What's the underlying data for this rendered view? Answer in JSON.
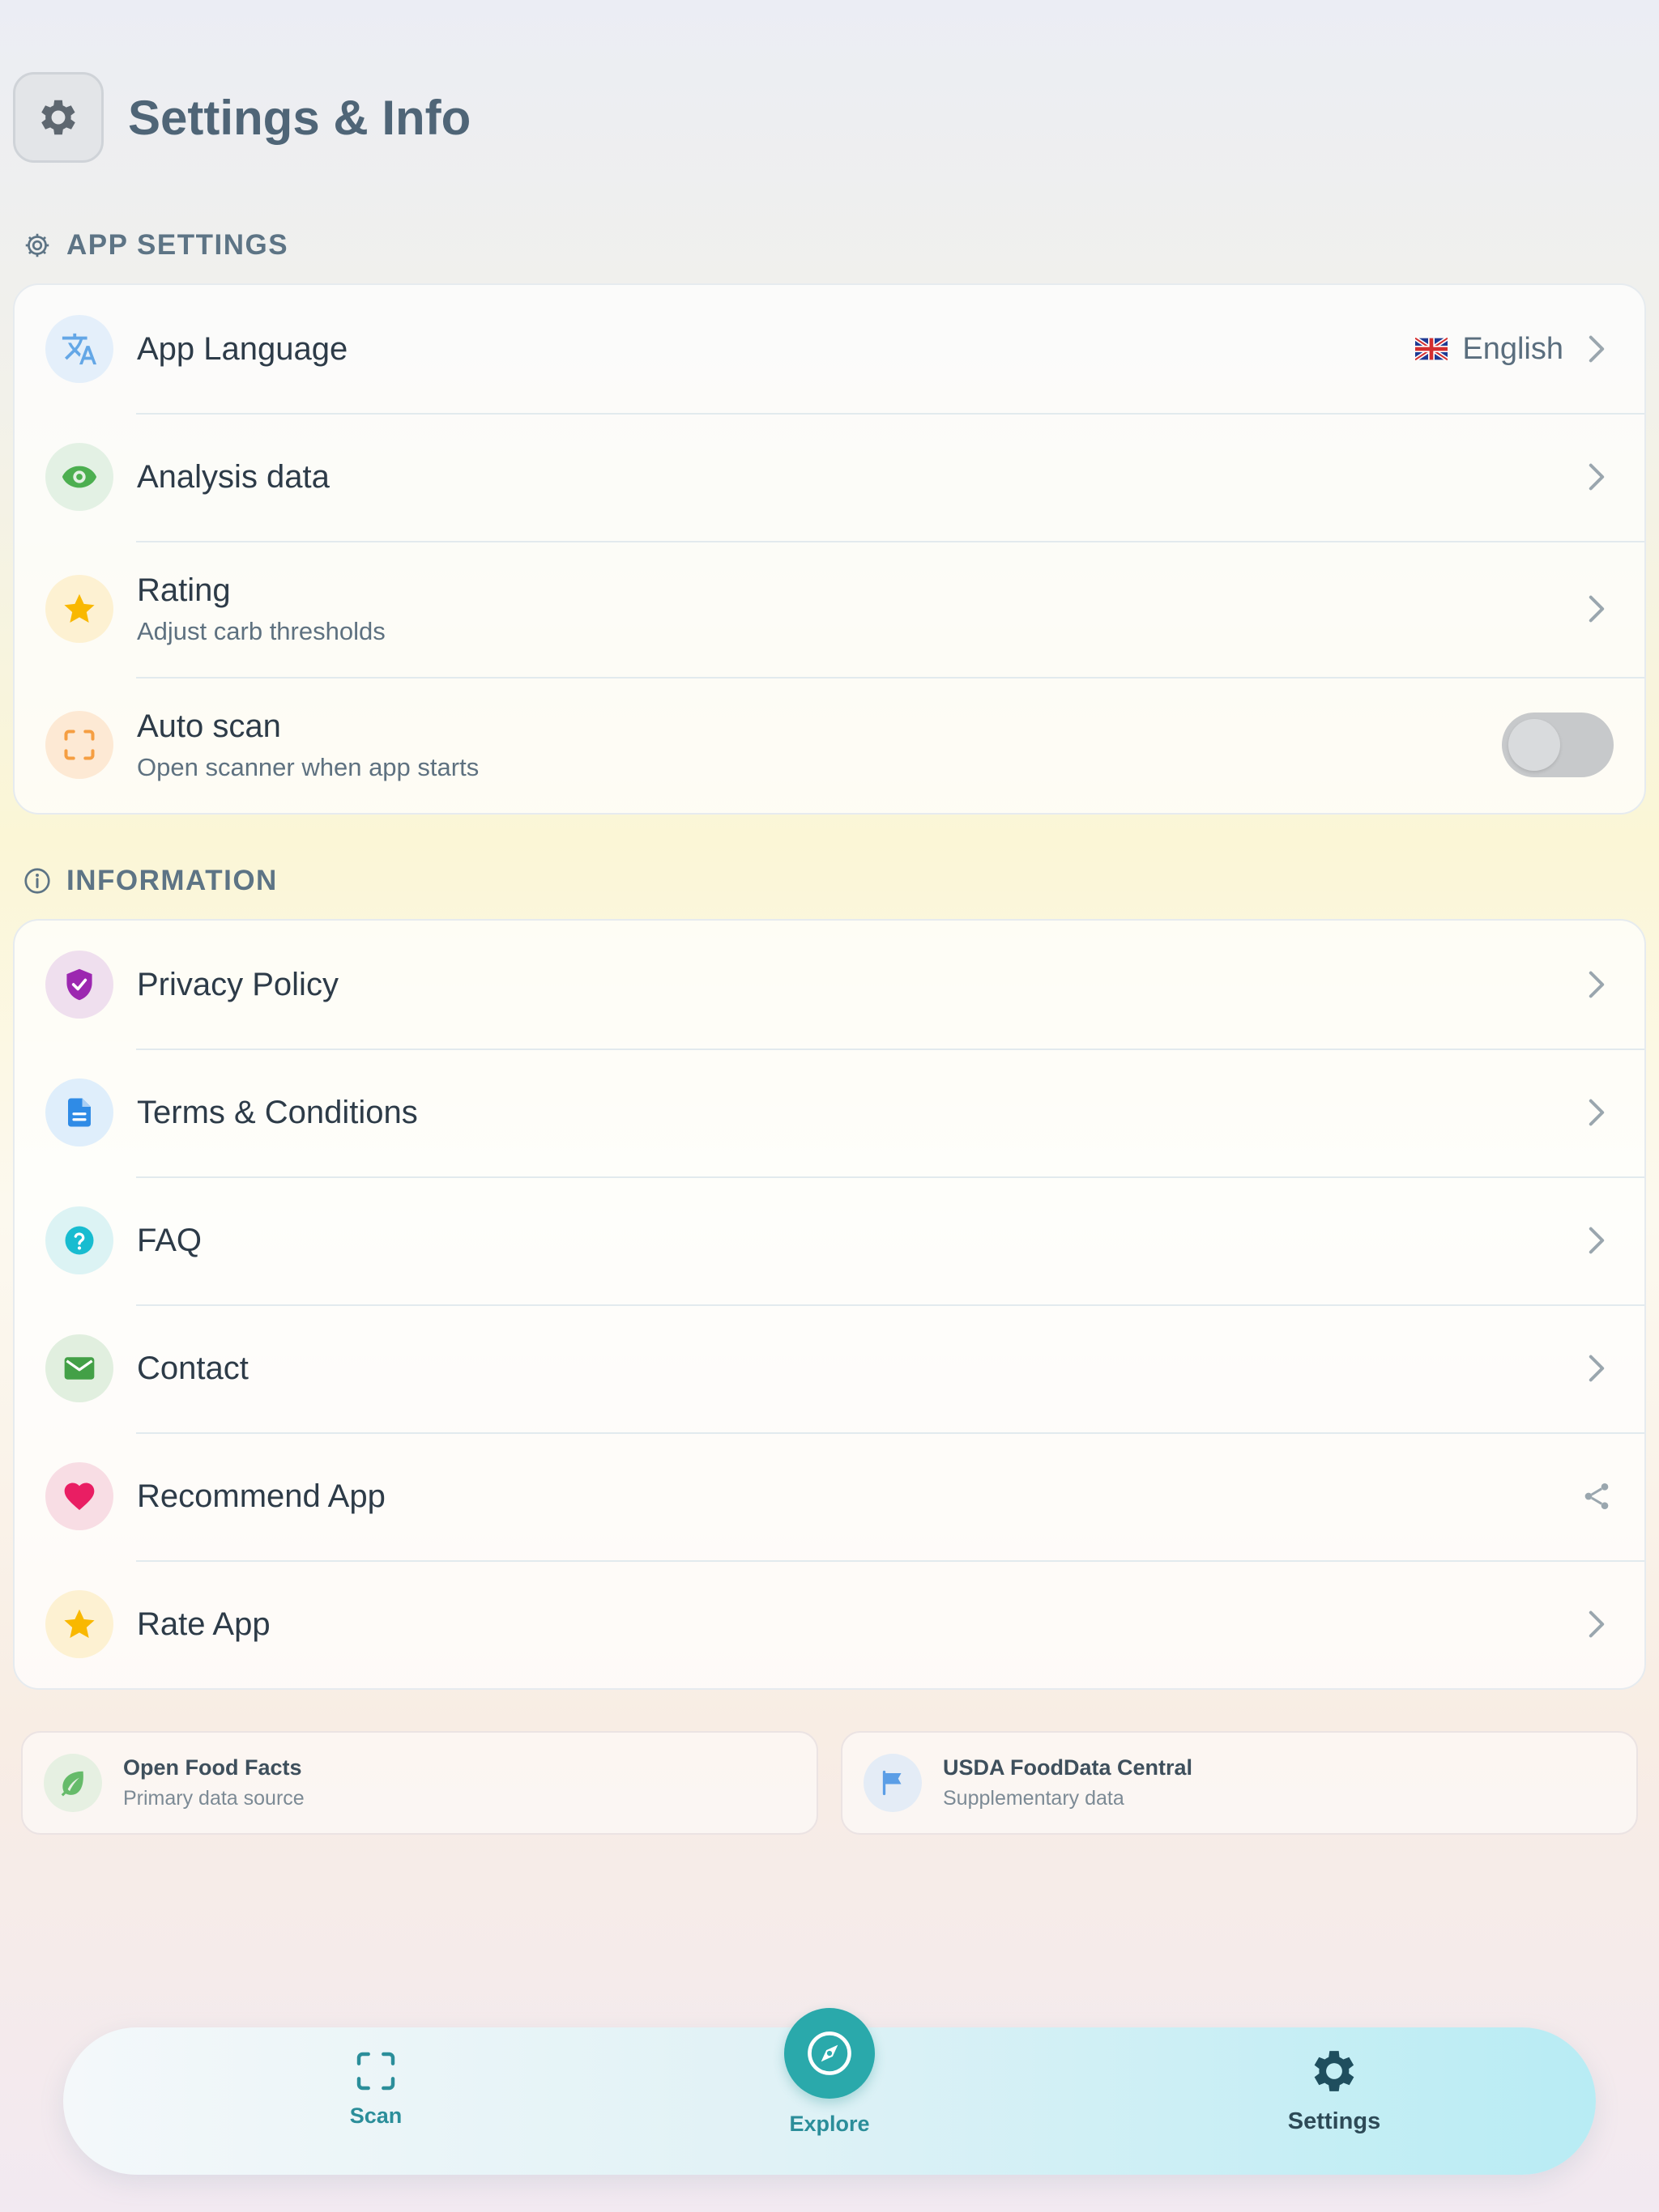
{
  "header": {
    "title": "Settings & Info",
    "icon": "gear-icon"
  },
  "app_settings": {
    "title": "APP SETTINGS",
    "items": [
      {
        "label": "App Language",
        "value": "English",
        "flag": "🇬🇧",
        "icon": "translate-icon",
        "icon_color": "#64a7e6",
        "icon_bg": "#e4effa"
      },
      {
        "label": "Analysis data",
        "icon": "eye-icon",
        "icon_color": "#4caf50",
        "icon_bg": "#e3f1e4"
      },
      {
        "label": "Rating",
        "sub": "Adjust carb thresholds",
        "icon": "star-icon",
        "icon_color": "#f9b800",
        "icon_bg": "#fdf1d2"
      },
      {
        "label": "Auto scan",
        "sub": "Open scanner when app starts",
        "icon": "scan-frame-icon",
        "icon_color": "#f59e42",
        "icon_bg": "#fde9d4",
        "toggle_on": false
      }
    ]
  },
  "information": {
    "title": "INFORMATION",
    "items": [
      {
        "label": "Privacy Policy",
        "icon": "shield-check-icon",
        "icon_color": "#9c27b0",
        "icon_bg": "#efdfee"
      },
      {
        "label": "Terms & Conditions",
        "icon": "document-icon",
        "icon_color": "#2f8be6",
        "icon_bg": "#dfeefb"
      },
      {
        "label": "FAQ",
        "icon": "question-icon",
        "icon_color": "#18bcd0",
        "icon_bg": "#dcf3f4"
      },
      {
        "label": "Contact",
        "icon": "mail-icon",
        "icon_color": "#43a047",
        "icon_bg": "#e1efdf"
      },
      {
        "label": "Recommend App",
        "icon": "heart-icon",
        "icon_color": "#e91e63",
        "icon_bg": "#f8dde4"
      },
      {
        "label": "Rate App",
        "icon": "star-icon",
        "icon_color": "#f9b800",
        "icon_bg": "#fdf1d2"
      }
    ]
  },
  "sources": [
    {
      "title": "Open Food Facts",
      "sub": "Primary data source",
      "icon": "leaf-icon",
      "icon_color": "#66bb6a"
    },
    {
      "title": "USDA FoodData Central",
      "sub": "Supplementary data",
      "icon": "flag-icon",
      "icon_color": "#5b9ee6"
    }
  ],
  "tabbar": {
    "tabs": [
      {
        "label": "Scan",
        "icon": "scan-frame-icon"
      },
      {
        "label": "Explore",
        "icon": "compass-icon"
      },
      {
        "label": "Settings",
        "icon": "gear-icon",
        "active": true
      }
    ],
    "accent": "#2aa9ab"
  }
}
